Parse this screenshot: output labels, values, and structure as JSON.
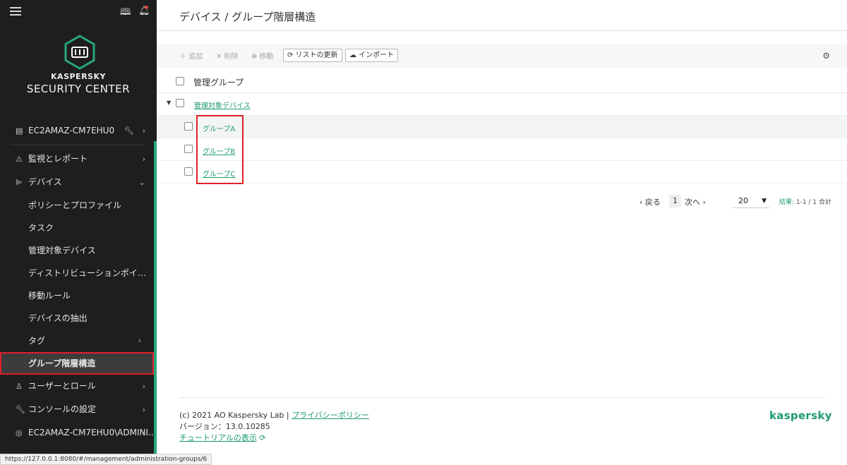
{
  "sidebar": {
    "brand_small": "KASPERSKY",
    "brand_big": "SECURITY CENTER",
    "server": "EC2AMAZ-CM7EHU0",
    "items": [
      {
        "label": "監視とレポート"
      },
      {
        "label": "デバイス"
      },
      {
        "label": "ユーザーとロール"
      },
      {
        "label": "コンソールの設定"
      },
      {
        "label": "EC2AMAZ-CM7EHU0\\ADMINI..."
      }
    ],
    "sub_items": [
      {
        "label": "ポリシーとプロファイル"
      },
      {
        "label": "タスク"
      },
      {
        "label": "管理対象デバイス"
      },
      {
        "label": "ディストリビューションポイン..."
      },
      {
        "label": "移動ルール"
      },
      {
        "label": "デバイスの抽出"
      },
      {
        "label": "タグ"
      },
      {
        "label": "グループ階層構造"
      }
    ]
  },
  "status_url": "https://127.0.0.1:8080/#/management/administration-groups/6",
  "main": {
    "title": "デバイス / グループ階層構造",
    "toolbar": {
      "add": "＋ 追加",
      "delete": "✕ 削除",
      "move": "✥ 移動",
      "refresh": "⟳ リストの更新",
      "import": "☁ インポート"
    },
    "table": {
      "header": "管理グループ",
      "root": "管理対象デバイス",
      "groups": [
        "グループA",
        "グループB",
        "グループC"
      ]
    },
    "pager": {
      "prev": "‹ 戻る",
      "page": "1",
      "next": "次へ ›",
      "page_size": "20",
      "result_label": "結果:",
      "result_value": "1-1 / 1 合計"
    },
    "footer": {
      "copyright": "(c) 2021 AO Kaspersky Lab | ",
      "privacy": "プライバシーポリシー",
      "version": "バージョン：13.0.10285",
      "tutorial": "チュートリアルの表示",
      "logo": "kaspersky"
    }
  },
  "colors": {
    "accent": "#1d9a73",
    "highlight": "#e0202a",
    "sidebar_bg": "#1e1e1e"
  }
}
